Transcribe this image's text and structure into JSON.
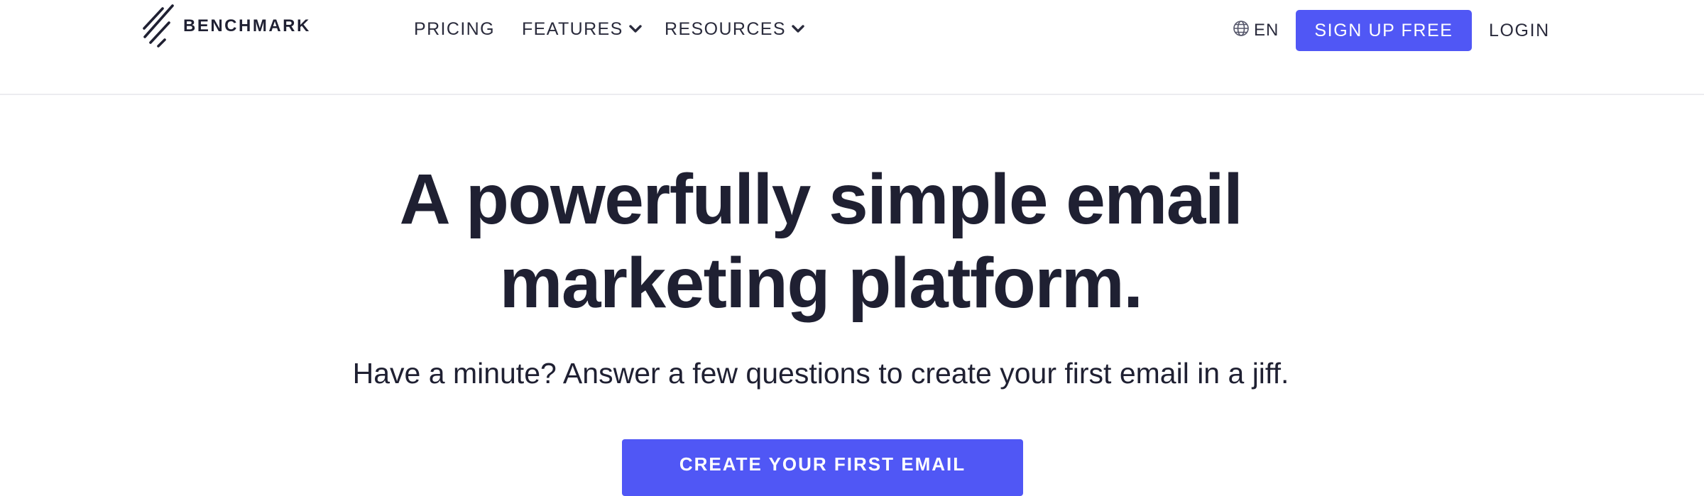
{
  "header": {
    "brand": "BENCHMARK",
    "nav": {
      "pricing": "PRICING",
      "features": "FEATURES",
      "resources": "RESOURCES"
    },
    "language": "EN",
    "signup_label": "SIGN UP FREE",
    "login_label": "LOGIN"
  },
  "hero": {
    "title_line1": "A powerfully simple email",
    "title_line2": "marketing platform.",
    "subtitle": "Have a minute? Answer a few questions to create your first email in a jiff.",
    "cta_label": "CREATE YOUR FIRST EMAIL"
  },
  "icons": {
    "logo": "benchmark-logo-icon",
    "globe": "globe-icon",
    "chevron": "chevron-down-icon"
  },
  "colors": {
    "accent": "#5057f5",
    "text": "#1f2032",
    "divider": "#ececf0"
  }
}
